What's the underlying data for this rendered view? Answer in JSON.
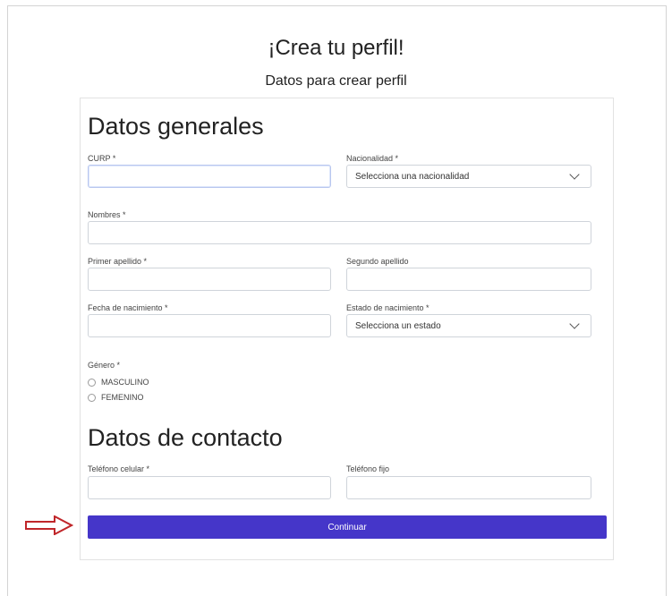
{
  "page": {
    "title": "¡Crea tu perfil!",
    "subtitle": "Datos para crear perfil"
  },
  "general": {
    "heading": "Datos generales",
    "curp_label": "CURP *",
    "curp_value": "",
    "nacionalidad_label": "Nacionalidad *",
    "nacionalidad_value": "Selecciona una nacionalidad",
    "nombres_label": "Nombres *",
    "nombres_value": "",
    "primer_apellido_label": "Primer apellido *",
    "segundo_apellido_label": "Segundo apellido",
    "fecha_label": "Fecha de nacimiento *",
    "estado_label": "Estado de nacimiento *",
    "estado_value": "Selecciona un estado",
    "genero_label": "Género *",
    "genero_options": [
      "MASCULINO",
      "FEMENINO"
    ]
  },
  "contact": {
    "heading": "Datos de contacto",
    "celular_label": "Teléfono celular *",
    "fijo_label": "Teléfono fijo"
  },
  "actions": {
    "continue_label": "Continuar"
  },
  "colors": {
    "button": "#4536c9",
    "annotation_arrow": "#c0262a"
  }
}
